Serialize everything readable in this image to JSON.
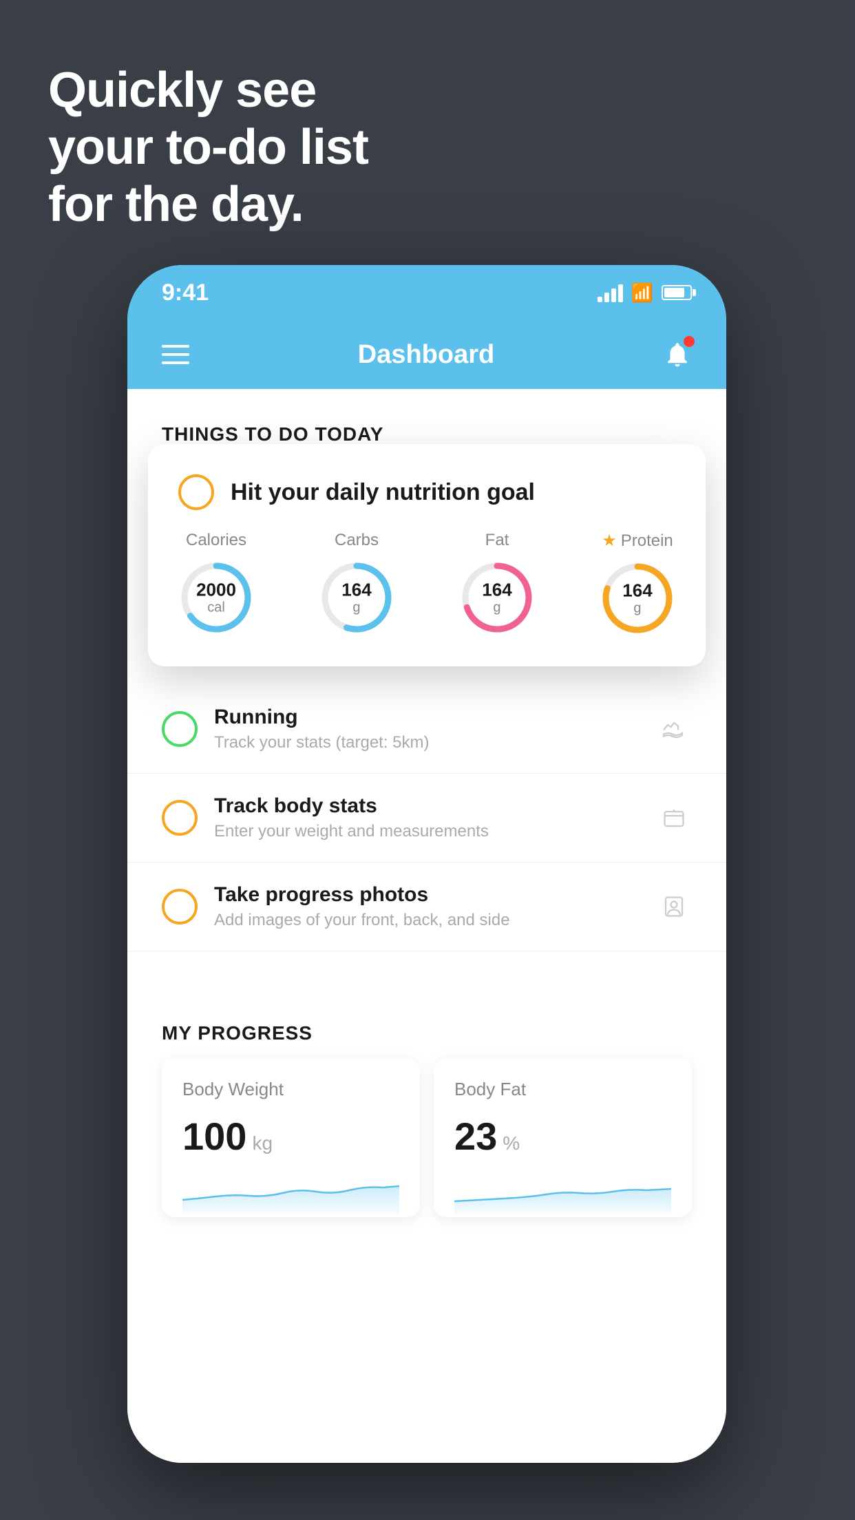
{
  "hero": {
    "line1": "Quickly see",
    "line2": "your to-do list",
    "line3": "for the day."
  },
  "phone": {
    "statusBar": {
      "time": "9:41"
    },
    "navBar": {
      "title": "Dashboard"
    },
    "sectionHeader": "THINGS TO DO TODAY",
    "floatingCard": {
      "mainItem": {
        "label": "Hit your daily nutrition goal"
      },
      "nutrition": [
        {
          "label": "Calories",
          "value": "2000",
          "unit": "cal",
          "color": "#5bc0eb",
          "percent": 65
        },
        {
          "label": "Carbs",
          "value": "164",
          "unit": "g",
          "color": "#5bc0eb",
          "percent": 55
        },
        {
          "label": "Fat",
          "value": "164",
          "unit": "g",
          "color": "#f06292",
          "percent": 70
        },
        {
          "label": "Protein",
          "value": "164",
          "unit": "g",
          "color": "#f5a623",
          "percent": 80,
          "starred": true
        }
      ]
    },
    "todoItems": [
      {
        "title": "Running",
        "subtitle": "Track your stats (target: 5km)",
        "checked": true,
        "icon": "shoe"
      },
      {
        "title": "Track body stats",
        "subtitle": "Enter your weight and measurements",
        "checked": false,
        "icon": "scale"
      },
      {
        "title": "Take progress photos",
        "subtitle": "Add images of your front, back, and side",
        "checked": false,
        "icon": "person"
      }
    ],
    "progressSection": {
      "header": "MY PROGRESS",
      "cards": [
        {
          "title": "Body Weight",
          "value": "100",
          "unit": "kg"
        },
        {
          "title": "Body Fat",
          "value": "23",
          "unit": "%"
        }
      ]
    }
  },
  "colors": {
    "background": "#3a3f47",
    "appBlue": "#5bc0eb"
  }
}
